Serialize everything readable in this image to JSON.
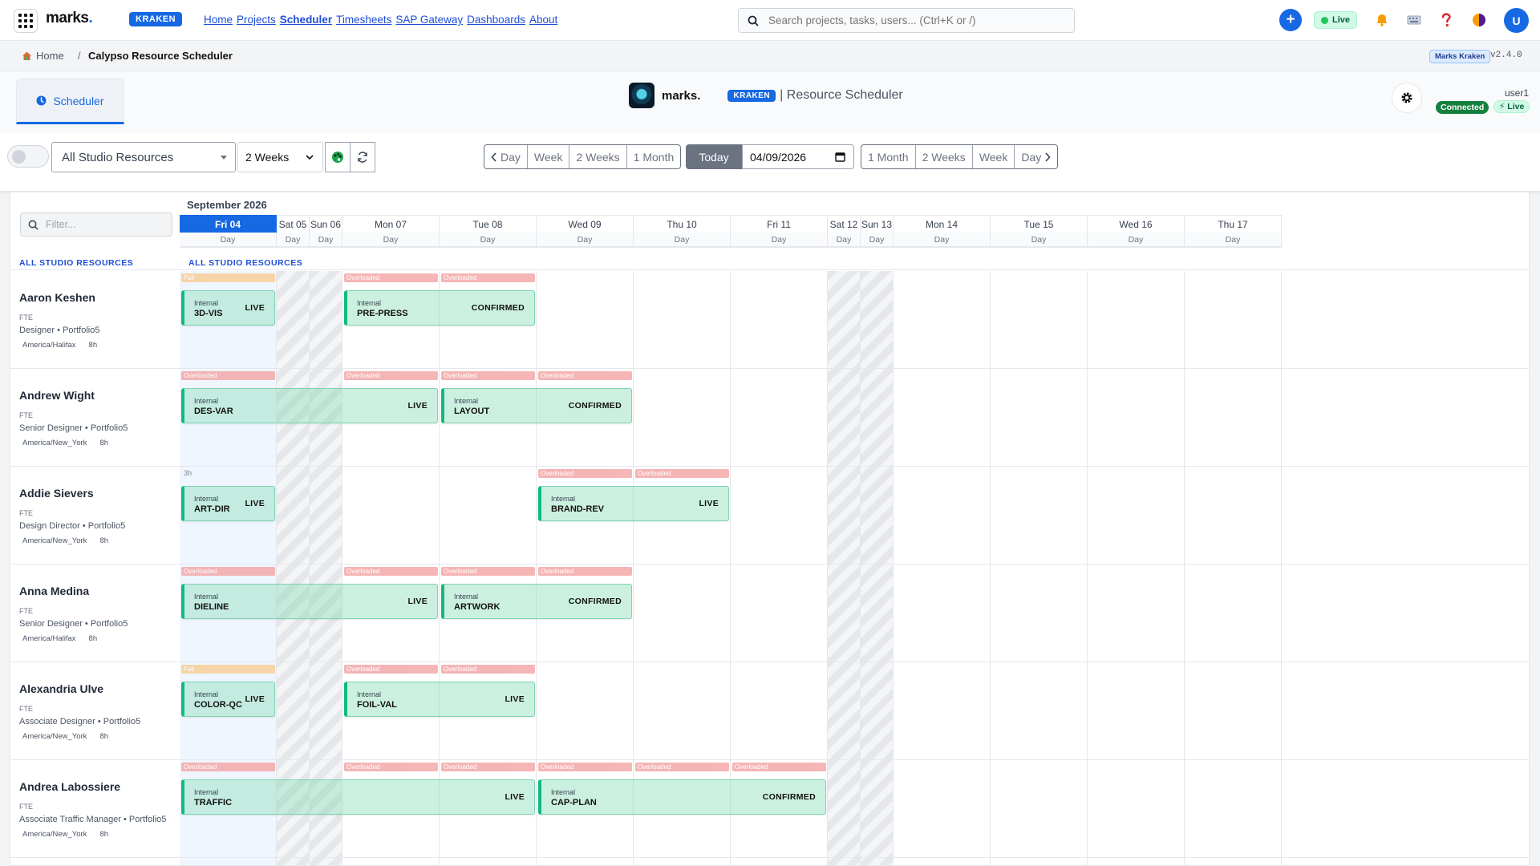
{
  "app": {
    "logo_main": "marks",
    "logo_dot": ".",
    "badge": "KRAKEN",
    "nav": [
      {
        "label": "Home",
        "active": false
      },
      {
        "label": "Projects",
        "active": false
      },
      {
        "label": "Scheduler",
        "active": true
      },
      {
        "label": "Timesheets",
        "active": false
      },
      {
        "label": "SAP Gateway",
        "active": false
      },
      {
        "label": "Dashboards",
        "active": false
      },
      {
        "label": "About",
        "active": false
      }
    ],
    "search_placeholder": "Search projects, tasks, users... (Ctrl+K or /)",
    "plus_label": "+",
    "live_label": "Live",
    "avatar_initial": "U"
  },
  "breadcrumb": {
    "home": "Home",
    "separator": "/",
    "current": "Calypso Resource Scheduler",
    "user_chip": "Marks Kraken",
    "version": "v2.4.0"
  },
  "header": {
    "tab_label": "Scheduler",
    "brand_text": "marks.",
    "badge": "KRAKEN",
    "title": "| Resource Scheduler",
    "user": "user1",
    "connected": "Connected",
    "live": "⚡ Live"
  },
  "toolbar": {
    "resource_select": "All Studio Resources",
    "range_select": "2 Weeks",
    "back_buttons": [
      "Day",
      "Week",
      "2 Weeks",
      "1 Month"
    ],
    "today": "Today",
    "date_value": "04/09/2026",
    "forward_buttons": [
      "1 Month",
      "2 Weeks",
      "Week",
      "Day"
    ]
  },
  "grid": {
    "filter_placeholder": "Filter...",
    "month": "September 2026",
    "group_label": "ALL STUDIO RESOURCES",
    "days": [
      {
        "label": "Fri 04",
        "sub": "Day",
        "type": "today"
      },
      {
        "label": "Sat 05",
        "sub": "Day",
        "type": "weekend"
      },
      {
        "label": "Sun 06",
        "sub": "Day",
        "type": "weekend"
      },
      {
        "label": "Mon 07",
        "sub": "Day",
        "type": "work"
      },
      {
        "label": "Tue 08",
        "sub": "Day",
        "type": "work"
      },
      {
        "label": "Wed 09",
        "sub": "Day",
        "type": "work"
      },
      {
        "label": "Thu 10",
        "sub": "Day",
        "type": "work"
      },
      {
        "label": "Fri 11",
        "sub": "Day",
        "type": "work"
      },
      {
        "label": "Sat 12",
        "sub": "Day",
        "type": "weekend"
      },
      {
        "label": "Sun 13",
        "sub": "Day",
        "type": "weekend"
      },
      {
        "label": "Mon 14",
        "sub": "Day",
        "type": "work"
      },
      {
        "label": "Tue 15",
        "sub": "Day",
        "type": "work"
      },
      {
        "label": "Wed 16",
        "sub": "Day",
        "type": "work"
      },
      {
        "label": "Thu 17",
        "sub": "Day",
        "type": "work"
      }
    ],
    "resources": [
      {
        "name": "Aaron Keshen",
        "type": "FTE",
        "role": "Designer • Portfolio5",
        "tz": "America/Halifax",
        "hours": "8h",
        "caps": [
          {
            "day": 0,
            "kind": "full",
            "label": "Full"
          },
          {
            "day": 3,
            "kind": "over",
            "label": "Overloaded"
          },
          {
            "day": 4,
            "kind": "over",
            "label": "Overloaded"
          }
        ],
        "bars": [
          {
            "start": 0,
            "end": 0,
            "kind": "Internal",
            "task": "3D-VIS",
            "status": "LIVE"
          },
          {
            "start": 3,
            "end": 4,
            "kind": "Internal",
            "task": "PRE-PRESS",
            "status": "CONFIRMED"
          }
        ]
      },
      {
        "name": "Andrew Wight",
        "type": "FTE",
        "role": "Senior Designer • Portfolio5",
        "tz": "America/New_York",
        "hours": "8h",
        "caps": [
          {
            "day": 0,
            "kind": "over",
            "label": "Overloaded"
          },
          {
            "day": 3,
            "kind": "over",
            "label": "Overloaded"
          },
          {
            "day": 4,
            "kind": "over",
            "label": "Overloaded"
          },
          {
            "day": 5,
            "kind": "over",
            "label": "Overloaded"
          }
        ],
        "bars": [
          {
            "start": 0,
            "end": 3,
            "kind": "Internal",
            "task": "DES-VAR",
            "status": "LIVE"
          },
          {
            "start": 4,
            "end": 5,
            "kind": "Internal",
            "task": "LAYOUT",
            "status": "CONFIRMED"
          }
        ]
      },
      {
        "name": "Addie Sievers",
        "type": "FTE",
        "role": "Design Director • Portfolio5",
        "tz": "America/New_York",
        "hours": "8h",
        "caps": [
          {
            "day": 0,
            "kind": "hrs",
            "label": "3h"
          },
          {
            "day": 5,
            "kind": "over",
            "label": "Overloaded"
          },
          {
            "day": 6,
            "kind": "over",
            "label": "Overloaded"
          }
        ],
        "bars": [
          {
            "start": 0,
            "end": 0,
            "kind": "Internal",
            "task": "ART-DIR",
            "status": "LIVE"
          },
          {
            "start": 5,
            "end": 6,
            "kind": "Internal",
            "task": "BRAND-REV",
            "status": "LIVE"
          }
        ]
      },
      {
        "name": "Anna Medina",
        "type": "FTE",
        "role": "Senior Designer • Portfolio5",
        "tz": "America/Halifax",
        "hours": "8h",
        "caps": [
          {
            "day": 0,
            "kind": "over",
            "label": "Overloaded"
          },
          {
            "day": 3,
            "kind": "over",
            "label": "Overloaded"
          },
          {
            "day": 4,
            "kind": "over",
            "label": "Overloaded"
          },
          {
            "day": 5,
            "kind": "over",
            "label": "Overloaded"
          }
        ],
        "bars": [
          {
            "start": 0,
            "end": 3,
            "kind": "Internal",
            "task": "DIELINE",
            "status": "LIVE"
          },
          {
            "start": 4,
            "end": 5,
            "kind": "Internal",
            "task": "ARTWORK",
            "status": "CONFIRMED"
          }
        ]
      },
      {
        "name": "Alexandria Ulve",
        "type": "FTE",
        "role": "Associate Designer • Portfolio5",
        "tz": "America/New_York",
        "hours": "8h",
        "caps": [
          {
            "day": 0,
            "kind": "full",
            "label": "Full"
          },
          {
            "day": 3,
            "kind": "over",
            "label": "Overloaded"
          },
          {
            "day": 4,
            "kind": "over",
            "label": "Overloaded"
          }
        ],
        "bars": [
          {
            "start": 0,
            "end": 0,
            "kind": "Internal",
            "task": "COLOR-QC",
            "status": "LIVE"
          },
          {
            "start": 3,
            "end": 4,
            "kind": "Internal",
            "task": "FOIL-VAL",
            "status": "LIVE"
          }
        ]
      },
      {
        "name": "Andrea Labossiere",
        "type": "FTE",
        "role": "Associate Traffic Manager • Portfolio5",
        "tz": "America/New_York",
        "hours": "8h",
        "caps": [
          {
            "day": 0,
            "kind": "over",
            "label": "Overloaded"
          },
          {
            "day": 3,
            "kind": "over",
            "label": "Overloaded"
          },
          {
            "day": 4,
            "kind": "over",
            "label": "Overloaded"
          },
          {
            "day": 5,
            "kind": "over",
            "label": "Overloaded"
          },
          {
            "day": 6,
            "kind": "over",
            "label": "Overloaded"
          },
          {
            "day": 7,
            "kind": "over",
            "label": "Overloaded"
          }
        ],
        "bars": [
          {
            "start": 0,
            "end": 4,
            "kind": "Internal",
            "task": "TRAFFIC",
            "status": "LIVE"
          },
          {
            "start": 5,
            "end": 7,
            "kind": "Internal",
            "task": "CAP-PLAN",
            "status": "CONFIRMED"
          }
        ]
      }
    ]
  }
}
